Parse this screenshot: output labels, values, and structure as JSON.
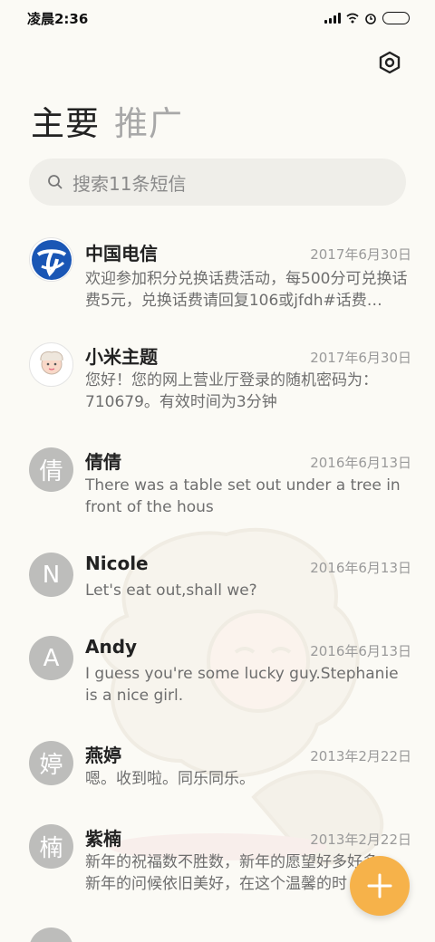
{
  "status": {
    "time": "凌晨2:36"
  },
  "tabs": [
    {
      "label": "主要"
    },
    {
      "label": "推广"
    }
  ],
  "search": {
    "text": "搜索11条短信"
  },
  "messages": [
    {
      "name": "中国电信",
      "date": "2017年6月30日",
      "preview": "欢迎参加积分兑换话费活动，每500分可兑换话费5元，兑换话费请回复106或jfdh#话费…",
      "avatar": ""
    },
    {
      "name": "小米主题",
      "date": "2017年6月30日",
      "preview": "您好！您的网上营业厅登录的随机密码为：710679。有效时间为3分钟",
      "avatar": ""
    },
    {
      "name": "倩倩",
      "date": "2016年6月13日",
      "preview": "There was a table set out under a tree in front of the hous",
      "avatar": "倩"
    },
    {
      "name": "Nicole",
      "date": "2016年6月13日",
      "preview": "Let's eat out,shall we?",
      "avatar": "N"
    },
    {
      "name": "Andy",
      "date": "2016年6月13日",
      "preview": "I guess you're some lucky guy.Stephanie is a nice girl.",
      "avatar": "A"
    },
    {
      "name": "燕婷",
      "date": "2013年2月22日",
      "preview": "嗯。收到啦。同乐同乐。",
      "avatar": "婷"
    },
    {
      "name": "紫楠",
      "date": "2013年2月22日",
      "preview": "新年的祝福数不胜数，新年的愿望好多好多，新年的问候依旧美好，在这个温馨的时",
      "avatar": "楠"
    }
  ],
  "colors": {
    "fab": "#f6b24a",
    "avatar": "#bdbdbb",
    "telecom": "#1a56b5"
  },
  "icons": {
    "settings": "gear-icon",
    "search": "search-icon",
    "compose": "plus-icon"
  }
}
